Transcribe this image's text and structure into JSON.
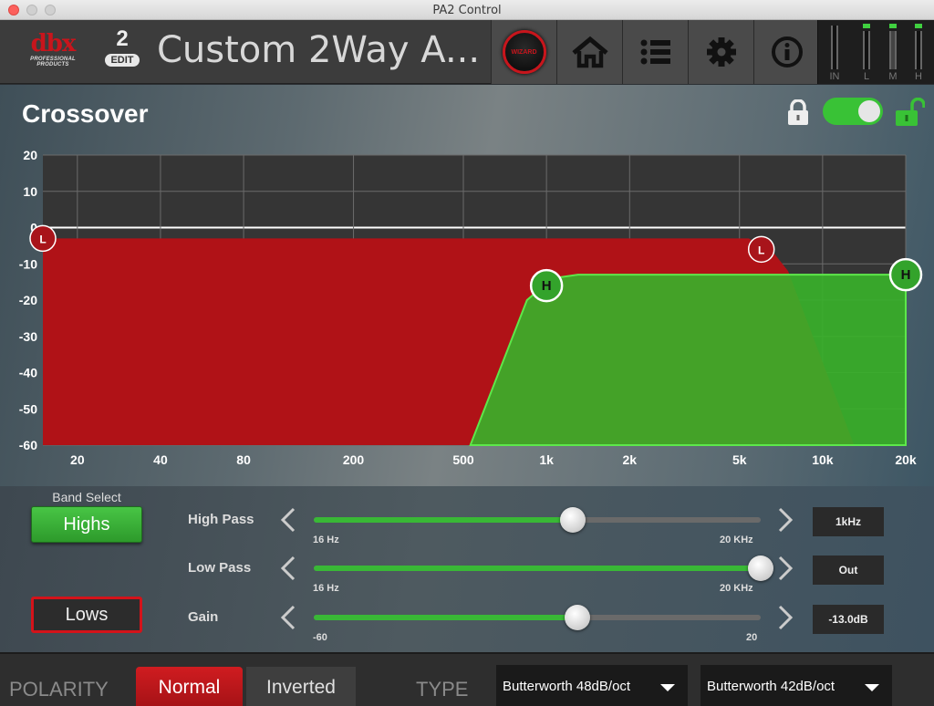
{
  "window": {
    "title": "PA2 Control"
  },
  "header": {
    "logo_brand": "dbx",
    "logo_sub": "PROFESSIONAL PRODUCTS",
    "preset_number": "2",
    "edit_label": "EDIT",
    "preset_name": "Custom 2Way A...",
    "wizard_label": "WIZARD",
    "meters": [
      "IN",
      "L",
      "M",
      "H"
    ]
  },
  "panel": {
    "title": "Crossover",
    "enabled": true,
    "accent_color": "#39c236"
  },
  "chart_data": {
    "type": "area",
    "xscale": "log",
    "xlim": [
      15,
      20000
    ],
    "ylim": [
      -60,
      20
    ],
    "yticks": [
      20,
      10,
      0,
      -10,
      -20,
      -30,
      -40,
      -50,
      -60
    ],
    "xticks": [
      {
        "value": 20,
        "label": "20"
      },
      {
        "value": 40,
        "label": "40"
      },
      {
        "value": 80,
        "label": "80"
      },
      {
        "value": 200,
        "label": "200"
      },
      {
        "value": 500,
        "label": "500"
      },
      {
        "value": 1000,
        "label": "1k"
      },
      {
        "value": 2000,
        "label": "2k"
      },
      {
        "value": 5000,
        "label": "5k"
      },
      {
        "value": 10000,
        "label": "10k"
      },
      {
        "value": 20000,
        "label": "20k"
      }
    ],
    "series": [
      {
        "band": "Lows",
        "color": "#b01217",
        "handles": [
          {
            "label": "L",
            "x": 15,
            "y": -3
          },
          {
            "label": "L",
            "x": 6000,
            "y": -6
          }
        ],
        "points": [
          [
            15,
            -3
          ],
          [
            5400,
            -3
          ],
          [
            6500,
            -6
          ],
          [
            7500,
            -12
          ],
          [
            13000,
            -60
          ]
        ]
      },
      {
        "band": "Highs",
        "color": "#38b32a",
        "handles": [
          {
            "label": "H",
            "x": 1000,
            "y": -16
          },
          {
            "label": "H",
            "x": 20000,
            "y": -13
          }
        ],
        "points": [
          [
            530,
            -60
          ],
          [
            850,
            -20
          ],
          [
            1050,
            -14
          ],
          [
            1300,
            -13
          ],
          [
            20000,
            -13
          ]
        ]
      }
    ]
  },
  "band_select": {
    "label": "Band Select",
    "highs": "Highs",
    "lows": "Lows"
  },
  "sliders": [
    {
      "label": "High Pass",
      "min_label": "16 Hz",
      "max_label": "20 KHz",
      "fraction": 0.58,
      "value": "1kHz"
    },
    {
      "label": "Low Pass",
      "min_label": "16 Hz",
      "max_label": "20 KHz",
      "fraction": 1.0,
      "value": "Out"
    },
    {
      "label": "Gain",
      "min_label": "-60",
      "max_label": "20",
      "fraction": 0.59,
      "value": "-13.0dB"
    }
  ],
  "footer": {
    "polarity_label": "POLARITY",
    "normal": "Normal",
    "inverted": "Inverted",
    "type_label": "TYPE",
    "type_high": "Butterworth 48dB/oct",
    "type_low": "Butterworth 42dB/oct"
  }
}
